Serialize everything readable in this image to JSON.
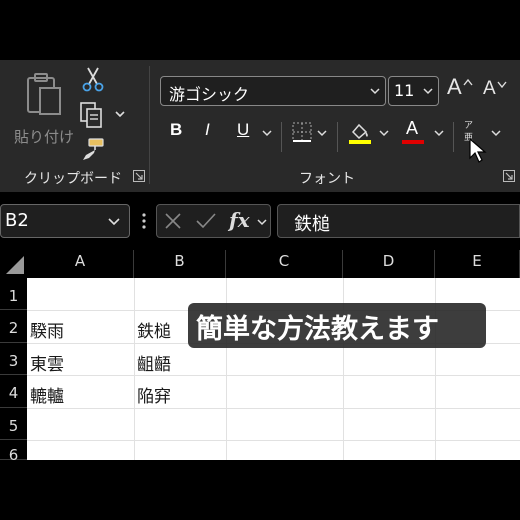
{
  "ribbon": {
    "clipboard": {
      "paste_label": "貼り付け",
      "group_label": "クリップボード",
      "icons": [
        "paste-icon",
        "cut-icon",
        "copy-icon",
        "format-painter-icon"
      ]
    },
    "font": {
      "font_name": "游ゴシック",
      "font_size": "11",
      "grow_label": "A",
      "shrink_label": "A",
      "bold_label": "B",
      "italic_label": "I",
      "underline_label": "U",
      "font_color_label": "A",
      "phonetic_label": "ア亜",
      "group_label": "フォント",
      "fill_color": "#ffff00",
      "font_color": "#e00000"
    }
  },
  "formula_bar": {
    "name_box": "B2",
    "formula_value": "鉄槌",
    "fx_label": "fx"
  },
  "sheet": {
    "columns": [
      "A",
      "B",
      "C",
      "D",
      "E"
    ],
    "rows": [
      "1",
      "2",
      "3",
      "4",
      "5",
      "6"
    ],
    "cells": {
      "A2": "騤雨",
      "B2": "鉄槌",
      "A3": "東雲",
      "B3": "齟齬",
      "A4": "轆轤",
      "B4": "陥穽"
    }
  },
  "caption": "簡単な方法教えます"
}
